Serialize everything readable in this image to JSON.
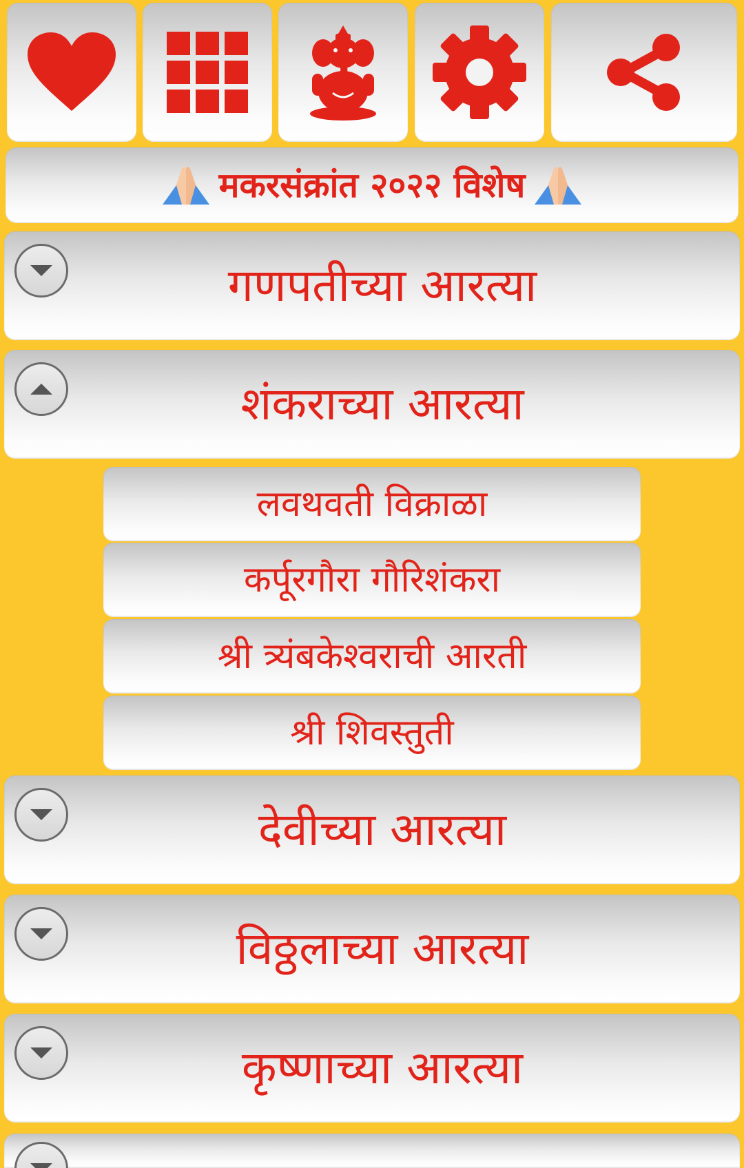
{
  "toolbar": {
    "icons": [
      "heart-icon",
      "grid-icon",
      "ganesha-icon",
      "gear-icon",
      "share-icon"
    ],
    "accent": "#e2231a"
  },
  "banner": {
    "text": "मकरसंक्रांत २०२२ विशेष",
    "emoji": "🙏"
  },
  "sections": [
    {
      "title": "गणपतीच्या आरत्या",
      "expanded": false
    },
    {
      "title": "शंकराच्या आरत्या",
      "expanded": true,
      "items": [
        "लवथवती विक्राळा",
        "कर्पूरगौरा गौरिशंकरा",
        "श्री त्र्यंबकेश्वराची आरती",
        "श्री शिवस्तुती"
      ]
    },
    {
      "title": "देवीच्या आरत्या",
      "expanded": false
    },
    {
      "title": "विठ्ठलाच्या आरत्या",
      "expanded": false
    },
    {
      "title": "कृष्णाच्या आरत्या",
      "expanded": false
    }
  ],
  "colors": {
    "background": "#fcc72c",
    "text": "#e2231a"
  }
}
